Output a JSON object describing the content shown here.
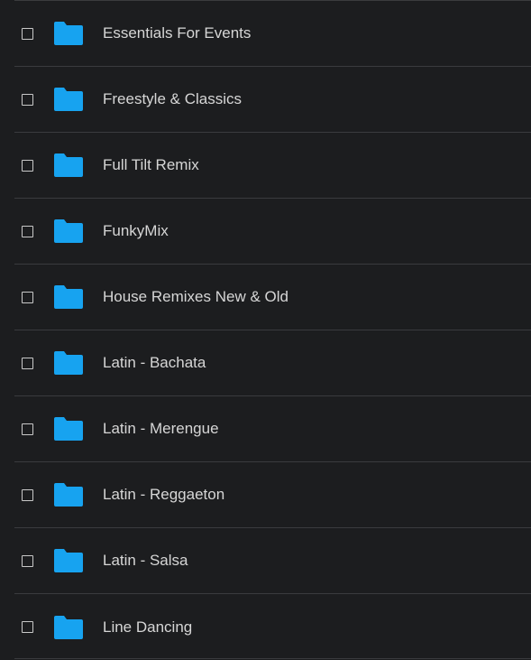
{
  "folders": [
    {
      "name": "Essentials For Events"
    },
    {
      "name": "Freestyle & Classics"
    },
    {
      "name": "Full Tilt Remix"
    },
    {
      "name": "FunkyMix"
    },
    {
      "name": "House Remixes New & Old"
    },
    {
      "name": "Latin - Bachata"
    },
    {
      "name": "Latin - Merengue"
    },
    {
      "name": "Latin - Reggaeton"
    },
    {
      "name": "Latin - Salsa"
    },
    {
      "name": "Line Dancing"
    }
  ],
  "colors": {
    "background": "#1c1d1f",
    "divider": "#3a3b3e",
    "folder": "#17a3f0",
    "text": "#d6d6d6",
    "checkbox": "#c9c9c9"
  },
  "icons": {
    "folder": "folder-icon",
    "checkbox": "checkbox-unchecked"
  }
}
